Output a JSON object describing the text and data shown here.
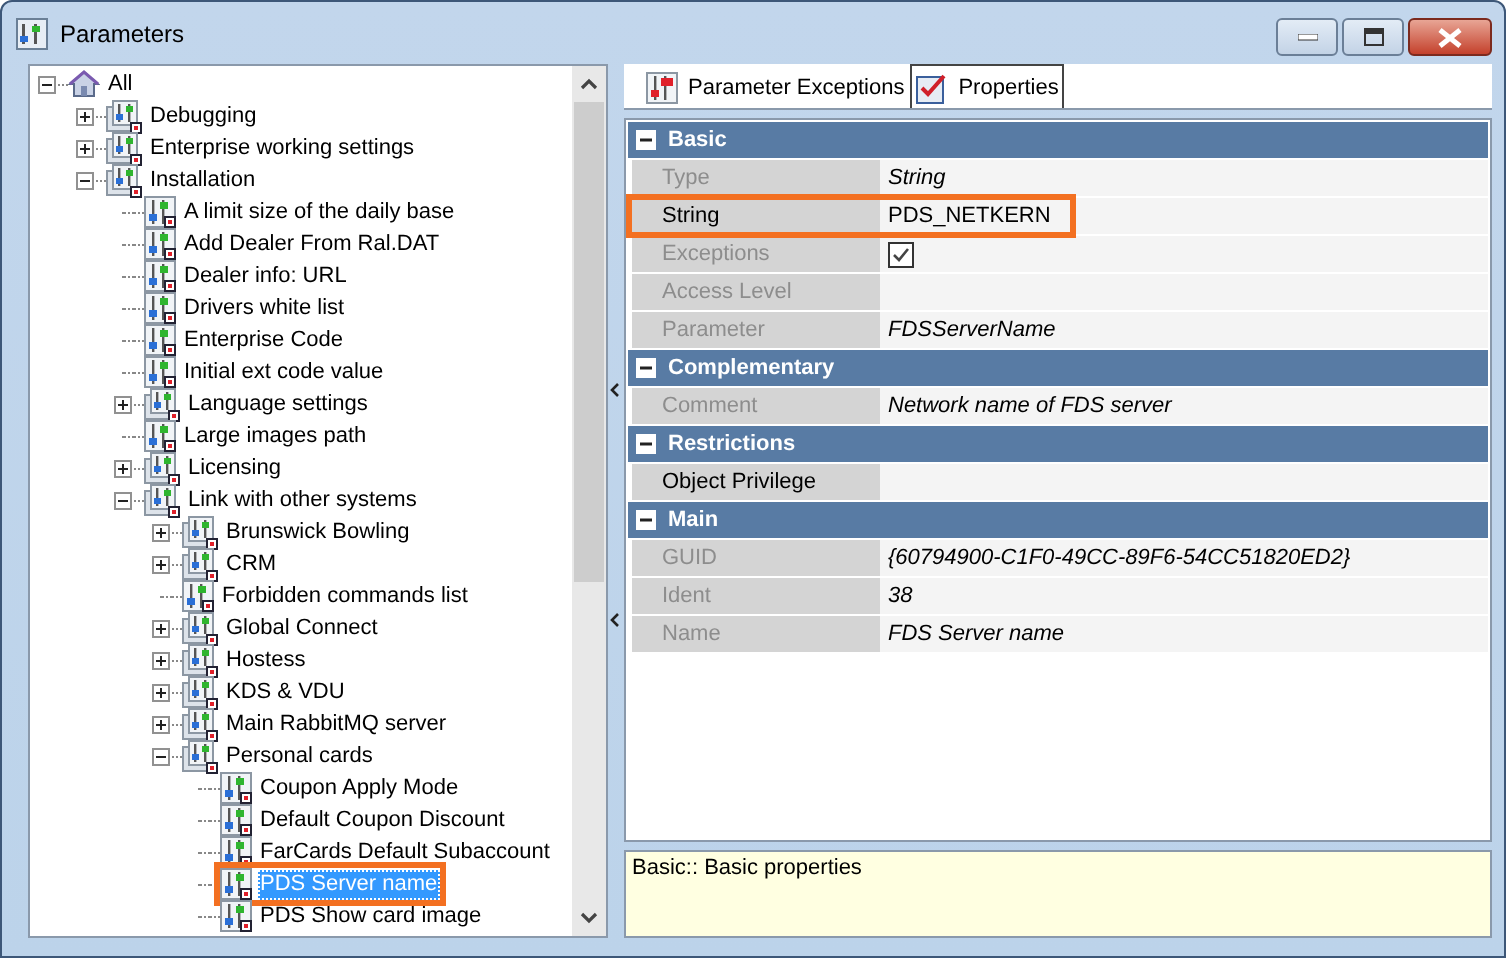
{
  "window": {
    "title": "Parameters"
  },
  "tree": [
    {
      "label": "All",
      "kind": "root",
      "expanded": true,
      "selected": false,
      "highlighted": false,
      "children": [
        {
          "label": "Debugging",
          "kind": "group",
          "expanded": false,
          "selected": false,
          "highlighted": false
        },
        {
          "label": "Enterprise working settings",
          "kind": "group",
          "expanded": false,
          "selected": false,
          "highlighted": false
        },
        {
          "label": "Installation",
          "kind": "group",
          "expanded": true,
          "selected": false,
          "highlighted": false,
          "children": [
            {
              "label": "A limit size of the daily base",
              "kind": "param",
              "selected": false,
              "highlighted": false
            },
            {
              "label": "Add Dealer From Ral.DAT",
              "kind": "param",
              "selected": false,
              "highlighted": false
            },
            {
              "label": "Dealer info: URL",
              "kind": "param",
              "selected": false,
              "highlighted": false
            },
            {
              "label": "Drivers white list",
              "kind": "param",
              "selected": false,
              "highlighted": false
            },
            {
              "label": "Enterprise Code",
              "kind": "param",
              "selected": false,
              "highlighted": false
            },
            {
              "label": "Initial ext code value",
              "kind": "param",
              "selected": false,
              "highlighted": false
            },
            {
              "label": "Language settings",
              "kind": "group",
              "expanded": false,
              "selected": false,
              "highlighted": false
            },
            {
              "label": "Large images path",
              "kind": "param",
              "selected": false,
              "highlighted": false
            },
            {
              "label": "Licensing",
              "kind": "group",
              "expanded": false,
              "selected": false,
              "highlighted": false
            },
            {
              "label": "Link with other systems",
              "kind": "group",
              "expanded": true,
              "selected": false,
              "highlighted": false,
              "children": [
                {
                  "label": "Brunswick Bowling",
                  "kind": "group",
                  "expanded": false,
                  "selected": false,
                  "highlighted": false
                },
                {
                  "label": "CRM",
                  "kind": "group",
                  "expanded": false,
                  "selected": false,
                  "highlighted": false
                },
                {
                  "label": "Forbidden commands list",
                  "kind": "param",
                  "selected": false,
                  "highlighted": false
                },
                {
                  "label": "Global Connect",
                  "kind": "group",
                  "expanded": false,
                  "selected": false,
                  "highlighted": false
                },
                {
                  "label": "Hostess",
                  "kind": "group",
                  "expanded": false,
                  "selected": false,
                  "highlighted": false
                },
                {
                  "label": "KDS & VDU",
                  "kind": "group",
                  "expanded": false,
                  "selected": false,
                  "highlighted": false
                },
                {
                  "label": "Main RabbitMQ server",
                  "kind": "group",
                  "expanded": false,
                  "selected": false,
                  "highlighted": false
                },
                {
                  "label": "Personal cards",
                  "kind": "group",
                  "expanded": true,
                  "selected": false,
                  "highlighted": false,
                  "children": [
                    {
                      "label": "Coupon Apply Mode",
                      "kind": "param",
                      "selected": false,
                      "highlighted": false
                    },
                    {
                      "label": "Default Coupon Discount",
                      "kind": "param",
                      "selected": false,
                      "highlighted": false
                    },
                    {
                      "label": "FarCards Default Subaccount",
                      "kind": "param",
                      "selected": false,
                      "highlighted": false
                    },
                    {
                      "label": "PDS Server name",
                      "kind": "param",
                      "selected": true,
                      "highlighted": true
                    },
                    {
                      "label": "PDS Show card image",
                      "kind": "param",
                      "selected": false,
                      "highlighted": false
                    }
                  ]
                }
              ]
            }
          ]
        }
      ]
    }
  ],
  "tabs": [
    {
      "label": "Parameter Exceptions",
      "kind": "exceptions",
      "selected": false
    },
    {
      "label": "Properties",
      "kind": "properties",
      "selected": true
    }
  ],
  "sections": [
    {
      "title": "Basic",
      "rows": [
        {
          "label": "Type",
          "value": "String",
          "kind": "text",
          "disabled": true,
          "highlighted": false
        },
        {
          "label": "String",
          "value": "PDS_NETKERN",
          "kind": "text",
          "disabled": false,
          "highlighted": true
        },
        {
          "label": "Exceptions",
          "kind": "check",
          "checked": true,
          "disabled": true,
          "highlighted": false
        },
        {
          "label": "Access Level",
          "kind": "text",
          "disabled": true,
          "highlighted": false
        },
        {
          "label": "Parameter",
          "value": "FDSServerName",
          "kind": "text",
          "disabled": true,
          "highlighted": false
        }
      ]
    },
    {
      "title": "Complementary",
      "rows": [
        {
          "label": "Comment",
          "value": "Network name of FDS server",
          "kind": "text",
          "disabled": true,
          "highlighted": false
        }
      ]
    },
    {
      "title": "Restrictions",
      "rows": [
        {
          "label": "Object Privilege",
          "kind": "text",
          "disabled": false,
          "highlighted": false
        }
      ]
    },
    {
      "title": "Main",
      "rows": [
        {
          "label": "GUID",
          "value": "{60794900-C1F0-49CC-89F6-54CC51820ED2}",
          "kind": "text",
          "disabled": true,
          "highlighted": false
        },
        {
          "label": "Ident",
          "value": "38",
          "kind": "text",
          "disabled": true,
          "highlighted": false
        },
        {
          "label": "Name",
          "value": "FDS Server name",
          "kind": "text",
          "disabled": true,
          "highlighted": false
        }
      ]
    }
  ],
  "description": "Basic:: Basic properties"
}
